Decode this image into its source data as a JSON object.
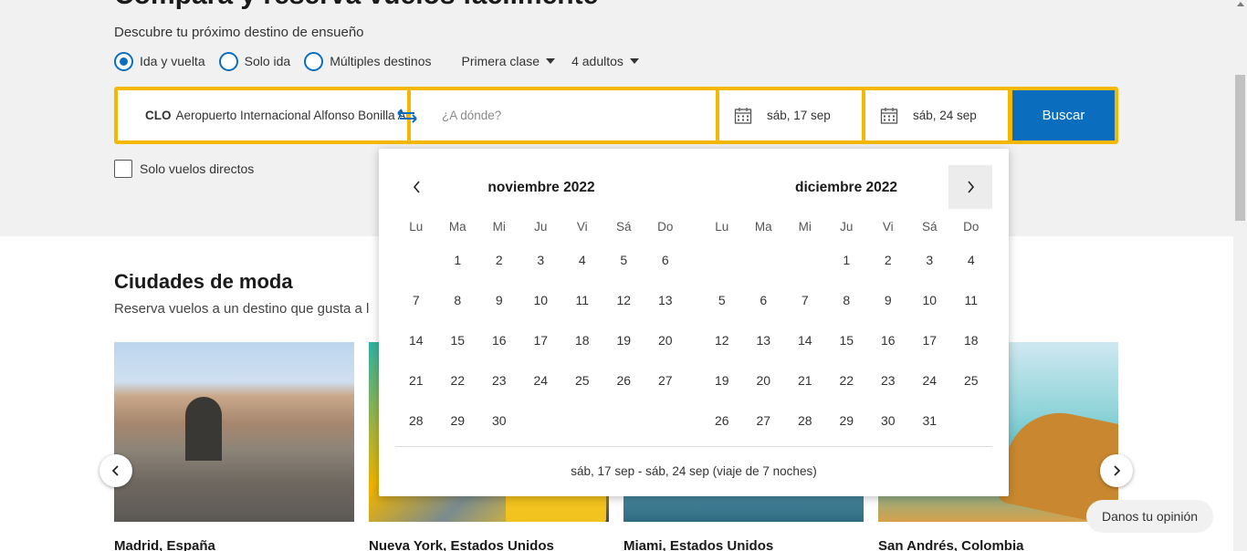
{
  "hero": {
    "title": "Compara y reserva vuelos fácilmente",
    "subtitle": "Descubre tu próximo destino de ensueño"
  },
  "trip_type": {
    "options": [
      "Ida y vuelta",
      "Solo ida",
      "Múltiples destinos"
    ],
    "selected": "Ida y vuelta"
  },
  "cabin_class": "Primera clase",
  "passengers": "4 adultos",
  "search": {
    "origin_code": "CLO",
    "origin_name": "Aeropuerto Internacional Alfonso Bonilla Aragón",
    "destination_placeholder": "¿A dónde?",
    "depart_date": "sáb, 17 sep",
    "return_date": "sáb, 24 sep",
    "button": "Buscar"
  },
  "direct_only": "Solo vuelos directos",
  "calendar": {
    "weekdays": [
      "Lu",
      "Ma",
      "Mi",
      "Ju",
      "Vi",
      "Sá",
      "Do"
    ],
    "months": [
      {
        "title": "noviembre 2022",
        "offset": 1,
        "days": [
          "1",
          "2",
          "3",
          "4",
          "5",
          "6",
          "7",
          "8",
          "9",
          "10",
          "11",
          "12",
          "13",
          "14",
          "15",
          "16",
          "17",
          "18",
          "19",
          "20",
          "21",
          "22",
          "23",
          "24",
          "25",
          "26",
          "27",
          "28",
          "29",
          "30"
        ]
      },
      {
        "title": "diciembre 2022",
        "offset": 3,
        "days": [
          "1",
          "2",
          "3",
          "4",
          "5",
          "6",
          "7",
          "8",
          "9",
          "10",
          "11",
          "12",
          "13",
          "14",
          "15",
          "16",
          "17",
          "18",
          "19",
          "20",
          "21",
          "22",
          "23",
          "24",
          "25",
          "26",
          "27",
          "28",
          "29",
          "30",
          "31"
        ]
      }
    ],
    "summary": "sáb, 17 sep - sáb, 24 sep (viaje de 7 noches)"
  },
  "trending": {
    "title": "Ciudades de moda",
    "subtitle": "Reserva vuelos a un destino que gusta a l",
    "cities": [
      "Madrid, España",
      "Nueva York, Estados Unidos",
      "Miami, Estados Unidos",
      "San Andrés, Colombia"
    ]
  },
  "feedback": "Danos tu opinión",
  "colors": {
    "accent_blue": "#0b6dbe",
    "search_border": "#f5b800",
    "hero_bg": "#f1f1f1"
  }
}
